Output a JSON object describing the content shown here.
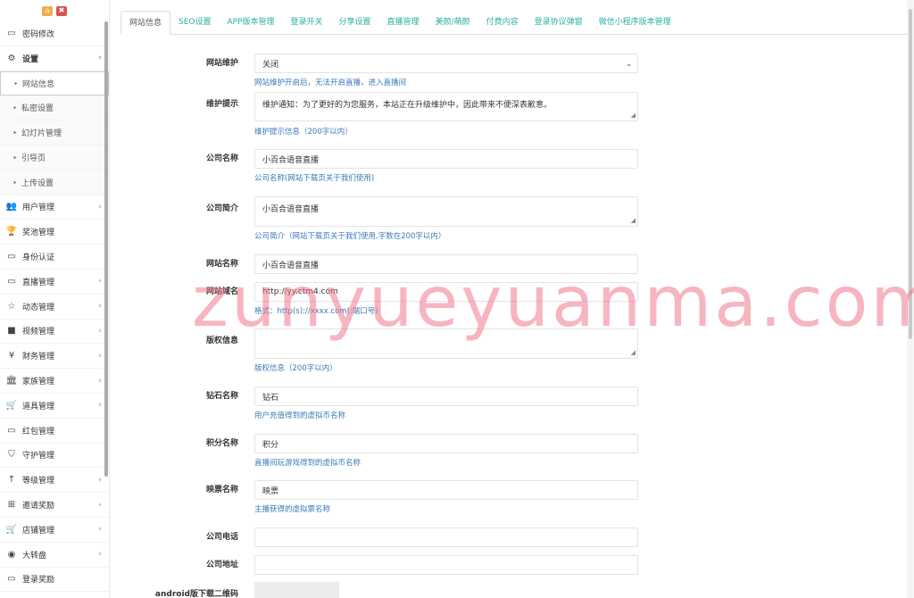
{
  "sidebar": {
    "items": [
      {
        "icon": "monitor-icon",
        "glyph": "▭",
        "label": "密码修改",
        "type": "item",
        "arrow": false
      },
      {
        "icon": "gears-icon",
        "glyph": "⚙",
        "label": "设置",
        "type": "open",
        "arrow": true
      },
      {
        "icon": "bullet-icon",
        "glyph": "▸",
        "label": "网站信息",
        "type": "sub-active",
        "arrow": false
      },
      {
        "icon": "bullet-icon",
        "glyph": "▸",
        "label": "私密设置",
        "type": "sub",
        "arrow": false
      },
      {
        "icon": "bullet-icon",
        "glyph": "▸",
        "label": "幻灯片管理",
        "type": "sub",
        "arrow": false
      },
      {
        "icon": "bullet-icon",
        "glyph": "▸",
        "label": "引导页",
        "type": "sub",
        "arrow": false
      },
      {
        "icon": "bullet-icon",
        "glyph": "▸",
        "label": "上传设置",
        "type": "sub",
        "arrow": false
      },
      {
        "icon": "users-icon",
        "glyph": "👥",
        "label": "用户管理",
        "type": "item",
        "arrow": true
      },
      {
        "icon": "trophy-icon",
        "glyph": "🏆",
        "label": "奖池管理",
        "type": "item",
        "arrow": false
      },
      {
        "icon": "monitor-icon",
        "glyph": "▭",
        "label": "身份认证",
        "type": "item",
        "arrow": false
      },
      {
        "icon": "monitor-icon",
        "glyph": "▭",
        "label": "直播管理",
        "type": "item",
        "arrow": true
      },
      {
        "icon": "star-icon",
        "glyph": "☆",
        "label": "动态管理",
        "type": "item",
        "arrow": true
      },
      {
        "icon": "video-icon",
        "glyph": "■",
        "label": "视频管理",
        "type": "item",
        "arrow": true
      },
      {
        "icon": "yen-icon",
        "glyph": "¥",
        "label": "财务管理",
        "type": "item",
        "arrow": true
      },
      {
        "icon": "bank-icon",
        "glyph": "🏛",
        "label": "家族管理",
        "type": "item",
        "arrow": true
      },
      {
        "icon": "cart-icon",
        "glyph": "🛒",
        "label": "道具管理",
        "type": "item",
        "arrow": true
      },
      {
        "icon": "monitor-icon",
        "glyph": "▭",
        "label": "红包管理",
        "type": "item",
        "arrow": false
      },
      {
        "icon": "shield-icon",
        "glyph": "⛉",
        "label": "守护管理",
        "type": "item",
        "arrow": false
      },
      {
        "icon": "level-up-icon",
        "glyph": "↑",
        "label": "等级管理",
        "type": "item",
        "arrow": true
      },
      {
        "icon": "sitemap-icon",
        "glyph": "⊞",
        "label": "邀请奖励",
        "type": "item",
        "arrow": true
      },
      {
        "icon": "cart-icon",
        "glyph": "🛒",
        "label": "店铺管理",
        "type": "item",
        "arrow": true
      },
      {
        "icon": "gamepad-icon",
        "glyph": "◉",
        "label": "大转盘",
        "type": "item",
        "arrow": true
      },
      {
        "icon": "monitor-icon",
        "glyph": "▭",
        "label": "登录奖励",
        "type": "item",
        "arrow": false
      }
    ]
  },
  "tabs": [
    "网站信息",
    "SEO设置",
    "APP版本管理",
    "登录开关",
    "分享设置",
    "直播管理",
    "美颜/萌颜",
    "付费内容",
    "登录协议弹窗",
    "微信小程序版本管理"
  ],
  "form": {
    "maintenance": {
      "label": "网站维护",
      "value": "关闭",
      "help": "网站维护开启后，无法开启直播，进入直播间"
    },
    "maintenance_tip": {
      "label": "维护提示",
      "value": "维护通知：为了更好的为您服务，本站正在升级维护中，因此带来不便深表歉意。",
      "help": "维护提示信息（200字以内）"
    },
    "company_name": {
      "label": "公司名称",
      "value": "小百合语音直播",
      "help": "公司名称(网站下载页关于我们使用)"
    },
    "company_intro": {
      "label": "公司简介",
      "value": "小百合语音直播",
      "help": "公司简介（网站下载页关于我们使用,字数在200字以内）"
    },
    "site_name": {
      "label": "网站名称",
      "value": "小百合语音直播"
    },
    "site_domain": {
      "label": "网站域名",
      "value": "http://yy.ctm4.com",
      "help": "格式：http(s)://xxxx.com(:端口号)"
    },
    "copyright": {
      "label": "版权信息",
      "value": "",
      "help": "版权信息（200字以内）"
    },
    "diamond": {
      "label": "钻石名称",
      "value": "钻石",
      "help": "用户充值得到的虚拟币名称"
    },
    "points": {
      "label": "积分名称",
      "value": "积分",
      "help": "直播间玩游戏得到的虚拟币名称"
    },
    "ticket": {
      "label": "映票名称",
      "value": "映票",
      "help": "主播获得的虚拟票名称"
    },
    "phone": {
      "label": "公司电话",
      "value": ""
    },
    "address": {
      "label": "公司地址",
      "value": ""
    },
    "android_qr": {
      "label": "android版下载二维码"
    }
  },
  "watermark": "zunyueyuanma.com"
}
